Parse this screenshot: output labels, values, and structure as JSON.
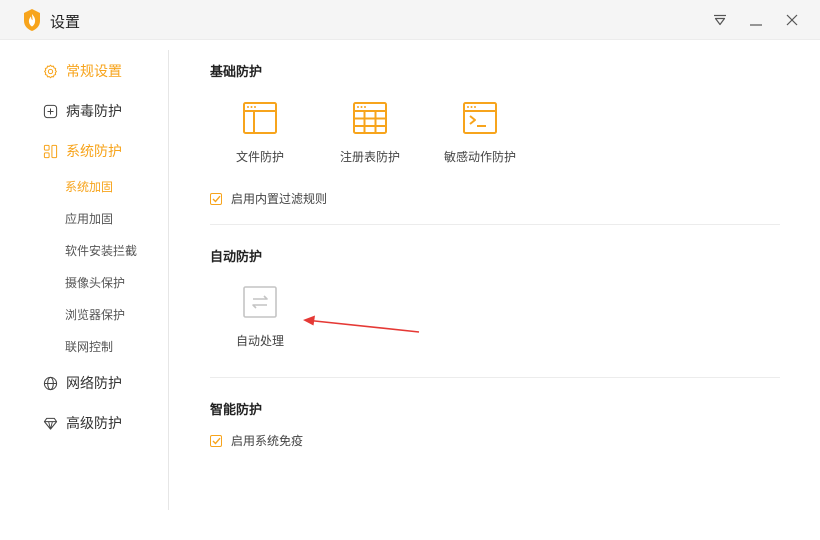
{
  "window": {
    "title": "设置",
    "controls": [
      "menu-dropdown-icon",
      "minimize-icon",
      "close-icon"
    ]
  },
  "sidebar": {
    "items": [
      {
        "label": "常规设置",
        "icon": "gear-icon",
        "active": true
      },
      {
        "label": "病毒防护",
        "icon": "plus-square-icon",
        "active": false
      },
      {
        "label": "系统防护",
        "icon": "grid-icon",
        "active": true
      },
      {
        "label": "网络防护",
        "icon": "globe-icon",
        "active": false
      },
      {
        "label": "高级防护",
        "icon": "diamond-icon",
        "active": false
      }
    ],
    "subitems": [
      "系统加固",
      "应用加固",
      "软件安装拦截",
      "摄像头保护",
      "浏览器保护",
      "联网控制"
    ],
    "active_subitem": "系统加固"
  },
  "sections": {
    "basic": {
      "title": "基础防护",
      "tiles": [
        {
          "label": "文件防护",
          "icon": "file-window-icon"
        },
        {
          "label": "注册表防护",
          "icon": "registry-grid-icon"
        },
        {
          "label": "敏感动作防护",
          "icon": "terminal-icon"
        }
      ],
      "checkbox": {
        "label": "启用内置过滤规则",
        "checked": true
      }
    },
    "auto": {
      "title": "自动防护",
      "tiles": [
        {
          "label": "自动处理",
          "icon": "swap-arrows-icon",
          "disabled": true
        }
      ]
    },
    "smart": {
      "title": "智能防护",
      "checkbox": {
        "label": "启用系统免疫",
        "checked": true
      }
    }
  },
  "colors": {
    "accent": "#f7a41c",
    "annotation_arrow": "#e53935",
    "disabled_icon": "#bfbfbf"
  }
}
